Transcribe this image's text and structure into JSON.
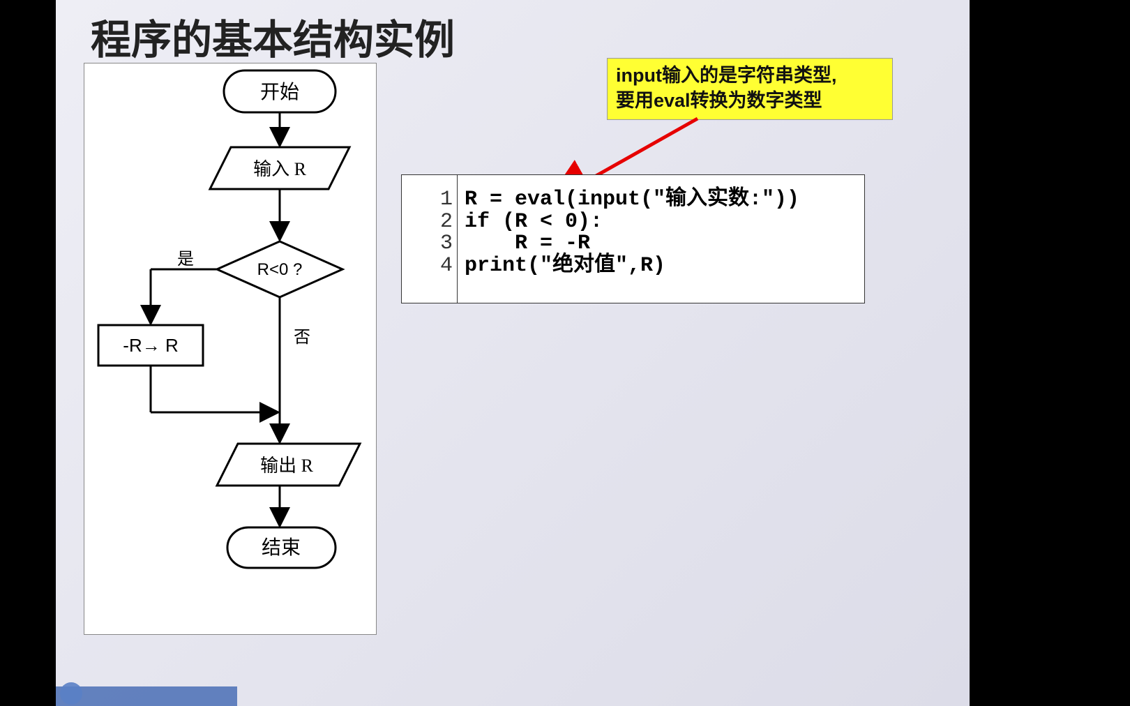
{
  "title": "程序的基本结构实例",
  "flowchart": {
    "start": "开始",
    "input": "输入 R",
    "decision": "R<0 ?",
    "yes": "是",
    "no": "否",
    "process": "-R→ R",
    "output": "输出 R",
    "end": "结束"
  },
  "note": {
    "line1": "input输入的是字符串类型,",
    "line2": "要用eval转换为数字类型"
  },
  "code": {
    "ln1": "1",
    "ln2": "2",
    "ln3": "3",
    "ln4": "4",
    "l1": "R = eval(input(\"输入实数:\"))",
    "l2": "if (R < 0):",
    "l3": "    R = -R",
    "l4": "print(\"绝对值\",R)"
  }
}
